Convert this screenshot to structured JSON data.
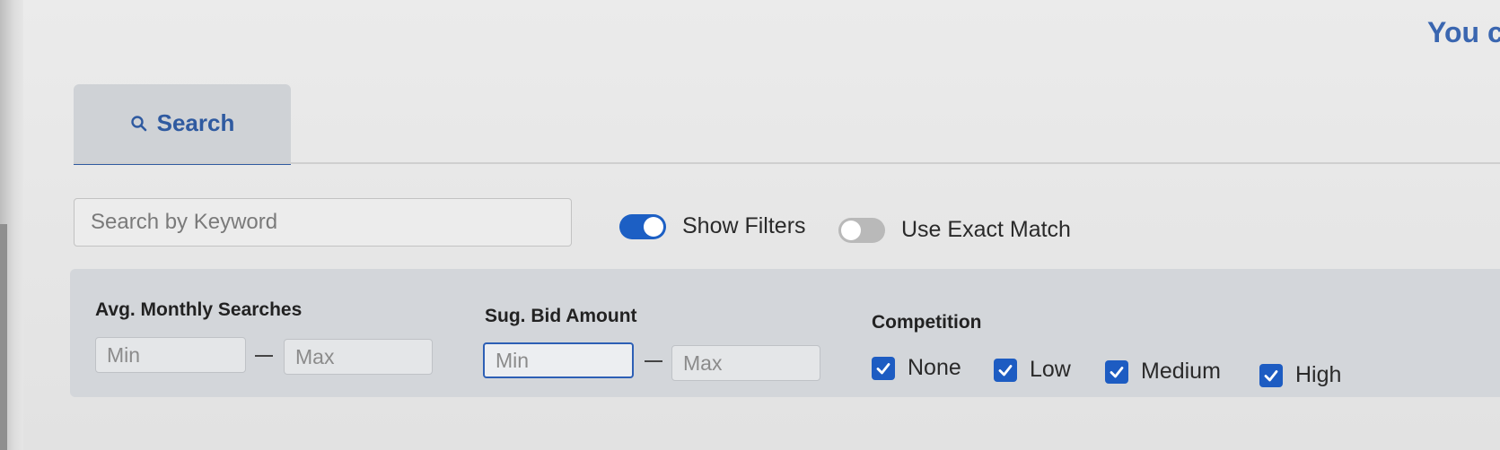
{
  "corner_text": "You c",
  "tab": {
    "label": "Search",
    "icon": "search-icon"
  },
  "search": {
    "placeholder": "Search by Keyword"
  },
  "toggles": [
    {
      "label": "Show Filters",
      "state": "on"
    },
    {
      "label": "Use Exact Match",
      "state": "off"
    }
  ],
  "filters": {
    "avg_monthly_searches": {
      "label": "Avg. Monthly Searches",
      "min_placeholder": "Min",
      "max_placeholder": "Max"
    },
    "sug_bid_amount": {
      "label": "Sug. Bid Amount",
      "min_placeholder": "Min",
      "max_placeholder": "Max"
    },
    "competition": {
      "label": "Competition",
      "options": [
        {
          "label": "None",
          "checked": true
        },
        {
          "label": "Low",
          "checked": true
        },
        {
          "label": "Medium",
          "checked": true
        },
        {
          "label": "High",
          "checked": true
        }
      ]
    }
  },
  "colors": {
    "accent": "#1d5cc2",
    "tab_text": "#2f5aa0"
  }
}
